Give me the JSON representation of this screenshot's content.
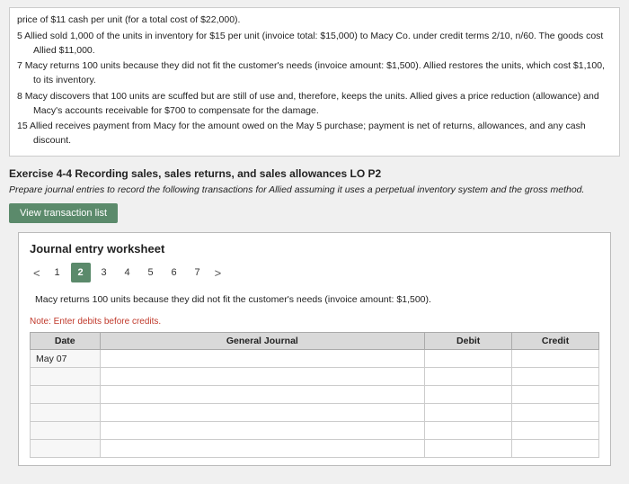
{
  "top_text": {
    "lines": [
      "price of $11 cash per unit (for a total cost of $22,000).",
      "5  Allied sold 1,000 of the units in inventory for $15 per unit (invoice total: $15,000) to Macy Co. under credit terms 2/10, n/60. The goods cost Allied $11,000.",
      "7  Macy returns 100 units because they did not fit the customer's needs (invoice amount: $1,500). Allied restores the units, which cost $1,100, to its inventory.",
      "8  Macy discovers that 100 units are scuffed but are still of use and, therefore, keeps the units. Allied gives a price reduction (allowance) and Macy's accounts receivable for $700 to compensate for the damage.",
      "15  Allied receives payment from Macy for the amount owed on the May 5 purchase; payment is net of returns, allowances, and any cash discount."
    ]
  },
  "exercise": {
    "title": "Exercise 4-4 Recording sales, sales returns, and sales allowances LO P2",
    "description": "Prepare journal entries to record the following transactions for Allied assuming it uses a perpetual inventory system and the gross method."
  },
  "view_btn": "View transaction list",
  "worksheet": {
    "title": "Journal entry worksheet",
    "pages": [
      "1",
      "2",
      "3",
      "4",
      "5",
      "6",
      "7"
    ],
    "active_page": "2",
    "left_arrow": "<",
    "right_arrow": ">",
    "transaction_desc": "Macy returns 100 units because they did not fit the customer's needs (invoice amount: $1,500).",
    "note": "Note: Enter debits before credits.",
    "table": {
      "headers": [
        "Date",
        "General Journal",
        "Debit",
        "Credit"
      ],
      "rows": [
        {
          "date": "May 07",
          "journal": "",
          "debit": "",
          "credit": ""
        },
        {
          "date": "",
          "journal": "",
          "debit": "",
          "credit": ""
        },
        {
          "date": "",
          "journal": "",
          "debit": "",
          "credit": ""
        },
        {
          "date": "",
          "journal": "",
          "debit": "",
          "credit": ""
        },
        {
          "date": "",
          "journal": "",
          "debit": "",
          "credit": ""
        },
        {
          "date": "",
          "journal": "",
          "debit": "",
          "credit": ""
        }
      ]
    }
  }
}
